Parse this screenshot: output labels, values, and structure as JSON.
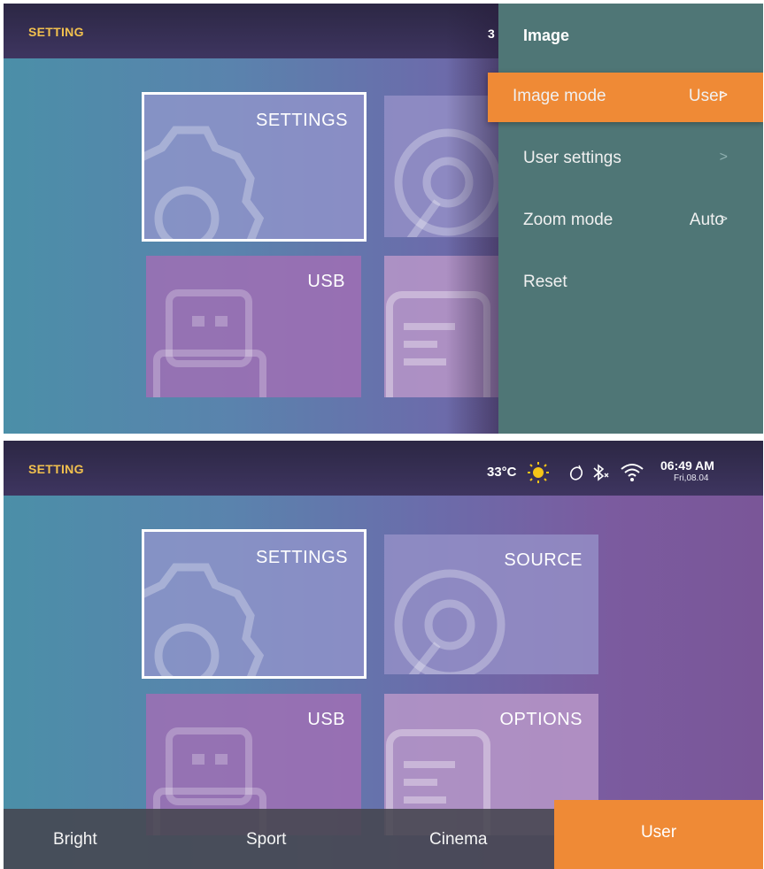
{
  "top_screen": {
    "header_title": "SETTING",
    "clipped_temp": "3",
    "tiles": {
      "settings": "SETTINGS",
      "usb": "USB"
    },
    "panel": {
      "title": "Image",
      "items": [
        {
          "label": "Image mode",
          "value": "User",
          "chevron": ">"
        },
        {
          "label": "User settings",
          "value": "",
          "chevron": ">"
        },
        {
          "label": "Zoom mode",
          "value": "Auto",
          "chevron": ">"
        },
        {
          "label": "Reset",
          "value": "",
          "chevron": ""
        }
      ]
    }
  },
  "bottom_screen": {
    "header_title": "SETTING",
    "status": {
      "temperature": "33°C",
      "time": "06:49 AM",
      "date": "Fri,08.04",
      "icons": [
        "sun-icon",
        "mouse-icon",
        "bluetooth-off-icon",
        "wifi-icon"
      ]
    },
    "tiles": {
      "settings": "SETTINGS",
      "source": "SOURCE",
      "usb": "USB",
      "options": "OPTIONS"
    },
    "modes": [
      "Bright",
      "Sport",
      "Cinema",
      "User"
    ],
    "selected_mode": "User"
  },
  "colors": {
    "accent": "#ef8a36",
    "header_title": "#f2c14e",
    "panel_bg": "#4f7676"
  }
}
